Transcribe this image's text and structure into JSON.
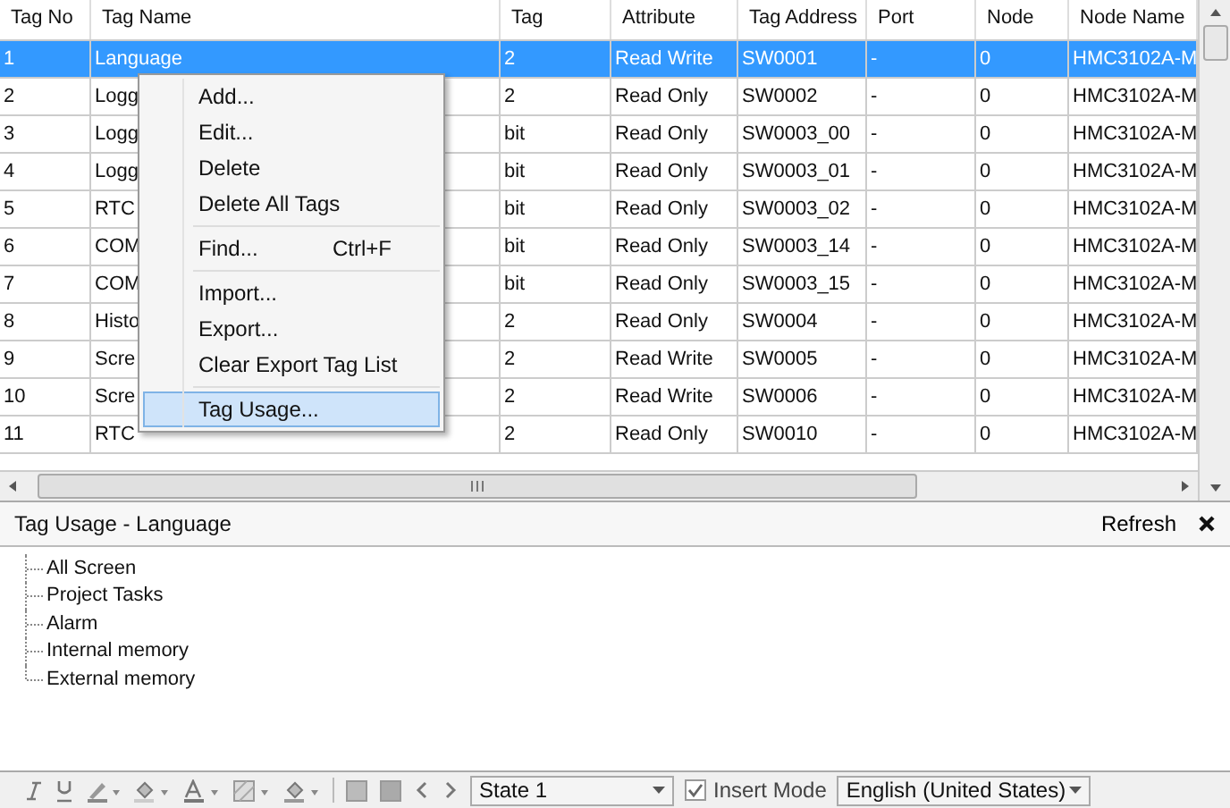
{
  "table": {
    "columns": [
      "Tag No",
      "Tag Name",
      "Tag",
      "Attribute",
      "Tag Address",
      "Port",
      "Node",
      "Node Name"
    ],
    "rows": [
      {
        "selected": true,
        "cells": [
          "1",
          "Language",
          "2",
          "Read Write",
          "SW0001",
          "-",
          "0",
          "HMC3102A-M"
        ]
      },
      {
        "selected": false,
        "cells": [
          "2",
          "Logg",
          "2",
          "Read Only",
          "SW0002",
          "-",
          "0",
          "HMC3102A-M"
        ]
      },
      {
        "selected": false,
        "cells": [
          "3",
          "Logg",
          "bit",
          "Read Only",
          "SW0003_00",
          "-",
          "0",
          "HMC3102A-M"
        ]
      },
      {
        "selected": false,
        "cells": [
          "4",
          "Logg",
          "bit",
          "Read Only",
          "SW0003_01",
          "-",
          "0",
          "HMC3102A-M"
        ]
      },
      {
        "selected": false,
        "cells": [
          "5",
          "RTC",
          "bit",
          "Read Only",
          "SW0003_02",
          "-",
          "0",
          "HMC3102A-M"
        ]
      },
      {
        "selected": false,
        "cells": [
          "6",
          "COM",
          "bit",
          "Read Only",
          "SW0003_14",
          "-",
          "0",
          "HMC3102A-M"
        ]
      },
      {
        "selected": false,
        "cells": [
          "7",
          "COM",
          "bit",
          "Read Only",
          "SW0003_15",
          "-",
          "0",
          "HMC3102A-M"
        ]
      },
      {
        "selected": false,
        "cells": [
          "8",
          "Histo",
          "2",
          "Read Only",
          "SW0004",
          "-",
          "0",
          "HMC3102A-M"
        ]
      },
      {
        "selected": false,
        "cells": [
          "9",
          "Scre",
          "2",
          "Read Write",
          "SW0005",
          "-",
          "0",
          "HMC3102A-M"
        ]
      },
      {
        "selected": false,
        "cells": [
          "10",
          "Scre",
          "2",
          "Read Write",
          "SW0006",
          "-",
          "0",
          "HMC3102A-M"
        ]
      },
      {
        "selected": false,
        "cells": [
          "11",
          "RTC",
          "2",
          "Read Only",
          "SW0010",
          "-",
          "0",
          "HMC3102A-M"
        ]
      }
    ]
  },
  "context_menu": {
    "groups": [
      [
        {
          "label": "Add...",
          "selected": false
        },
        {
          "label": "Edit...",
          "selected": false
        },
        {
          "label": "Delete",
          "selected": false
        },
        {
          "label": "Delete All Tags",
          "selected": false
        }
      ],
      [
        {
          "label": "Find...",
          "shortcut": "Ctrl+F",
          "selected": false
        }
      ],
      [
        {
          "label": "Import...",
          "selected": false
        },
        {
          "label": "Export...",
          "selected": false
        },
        {
          "label": "Clear Export Tag List",
          "selected": false
        }
      ],
      [
        {
          "label": "Tag Usage...",
          "selected": true
        }
      ]
    ]
  },
  "tag_usage": {
    "title": "Tag Usage -  Language",
    "refresh": "Refresh",
    "tree": [
      "All Screen",
      "Project Tasks",
      "Alarm",
      "Internal memory",
      "External memory"
    ]
  },
  "toolbar": {
    "state": "State 1",
    "insert_mode": {
      "label": "Insert Mode",
      "checked": true
    },
    "language": "English (United States)"
  }
}
